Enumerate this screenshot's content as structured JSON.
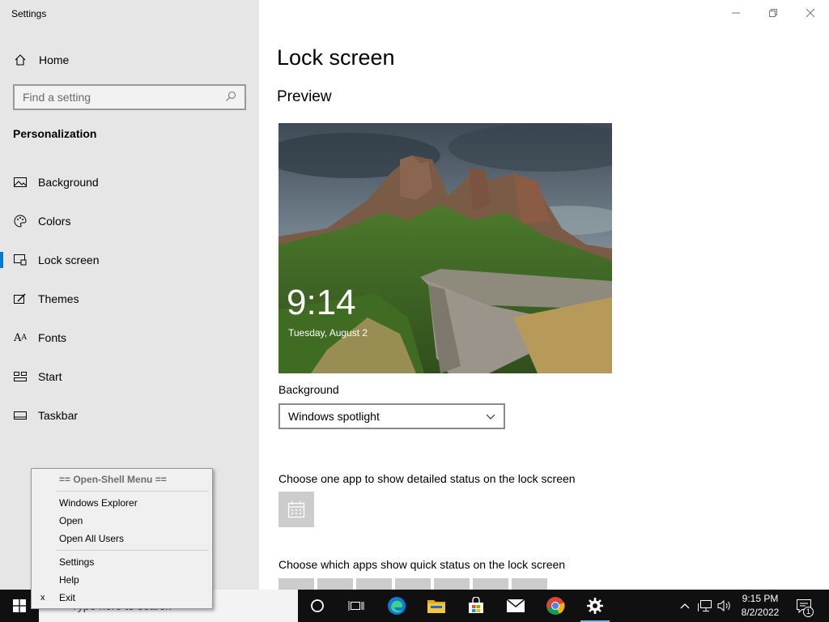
{
  "window": {
    "title": "Settings"
  },
  "sidebar": {
    "home_label": "Home",
    "search_placeholder": "Find a setting",
    "section_title": "Personalization",
    "items": [
      {
        "label": "Background",
        "icon": "picture-icon"
      },
      {
        "label": "Colors",
        "icon": "palette-icon"
      },
      {
        "label": "Lock screen",
        "icon": "lock-screen-icon",
        "selected": true
      },
      {
        "label": "Themes",
        "icon": "themes-icon"
      },
      {
        "label": "Fonts",
        "icon": "fonts-icon"
      },
      {
        "label": "Start",
        "icon": "start-icon"
      },
      {
        "label": "Taskbar",
        "icon": "taskbar-icon"
      }
    ]
  },
  "main": {
    "title": "Lock screen",
    "preview_heading": "Preview",
    "preview_time": "9:14",
    "preview_date": "Tuesday, August 2",
    "background_label": "Background",
    "background_value": "Windows spotlight",
    "detailed_status_label": "Choose one app to show detailed status on the lock screen",
    "detailed_status_app_icon": "calendar-icon",
    "quick_status_label": "Choose which apps show quick status on the lock screen"
  },
  "context_menu": {
    "header": "== Open-Shell Menu ==",
    "items": [
      "Windows Explorer",
      "Open",
      "Open All Users",
      "Settings",
      "Help",
      "Exit"
    ],
    "exit_glyph": "x"
  },
  "taskbar": {
    "search_placeholder": "Type here to search",
    "apps": [
      "cortana-icon",
      "task-view-icon",
      "edge-icon",
      "file-explorer-icon",
      "store-icon",
      "mail-icon",
      "chrome-icon",
      "settings-icon"
    ],
    "active_app": "settings-icon",
    "time": "9:15 PM",
    "date": "8/2/2022",
    "notification_count": "1"
  },
  "colors": {
    "accent": "#0078d7",
    "sidebar_bg": "#e6e6e6",
    "taskbar_bg": "#101010"
  }
}
